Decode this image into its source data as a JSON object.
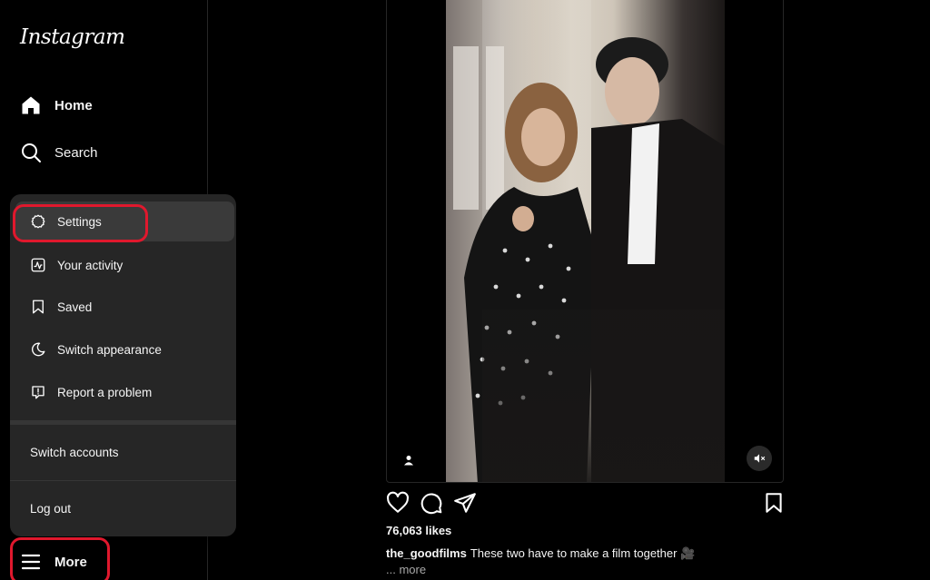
{
  "app": {
    "logo": "Instagram"
  },
  "sidebar": {
    "items": [
      {
        "label": "Home",
        "icon": "home-icon"
      },
      {
        "label": "Search",
        "icon": "search-icon"
      }
    ],
    "more_label": "More"
  },
  "more_menu": {
    "items": [
      {
        "label": "Settings",
        "icon": "settings-icon",
        "highlighted": true
      },
      {
        "label": "Your activity",
        "icon": "activity-icon"
      },
      {
        "label": "Saved",
        "icon": "bookmark-icon"
      },
      {
        "label": "Switch appearance",
        "icon": "moon-icon"
      },
      {
        "label": "Report a problem",
        "icon": "report-icon"
      }
    ],
    "switch_accounts": "Switch accounts",
    "log_out": "Log out"
  },
  "post": {
    "likes": "76,063 likes",
    "username": "the_goodfilms",
    "caption": "These two have to make a film together 🎥",
    "more": "... more"
  },
  "colors": {
    "background": "#000000",
    "menu_bg": "#262626",
    "highlight": "#e0182d"
  }
}
